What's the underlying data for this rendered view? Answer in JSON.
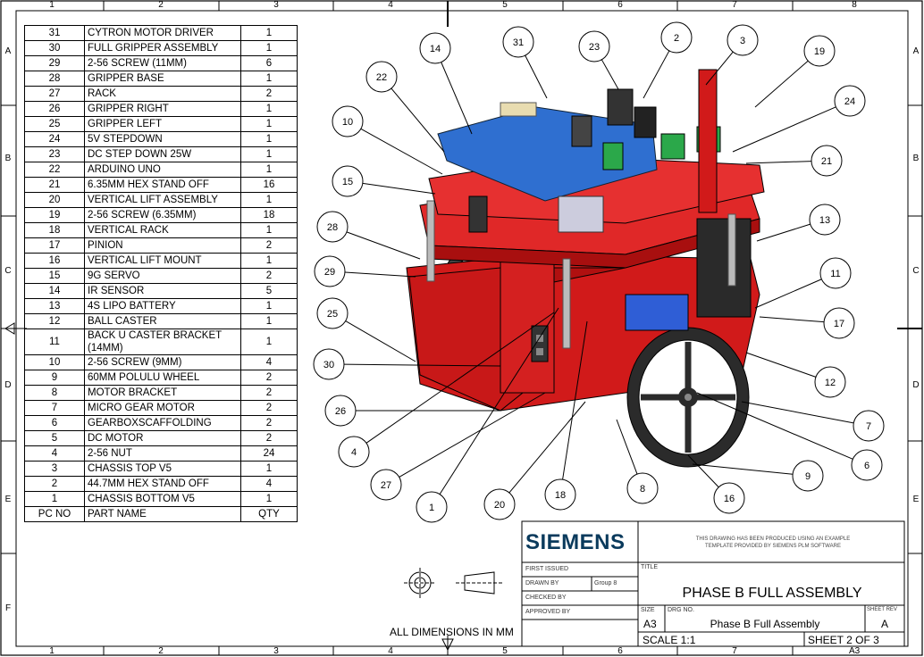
{
  "frame": {
    "columns": [
      "1",
      "2",
      "3",
      "4",
      "5",
      "6",
      "7",
      "8"
    ],
    "rows": [
      "A",
      "B",
      "C",
      "D",
      "E",
      "F"
    ]
  },
  "bom": {
    "rows": [
      {
        "no": "31",
        "name": "CYTRON MOTOR DRIVER",
        "qty": "1"
      },
      {
        "no": "30",
        "name": "FULL GRIPPER ASSEMBLY",
        "qty": "1"
      },
      {
        "no": "29",
        "name": "2-56 SCREW (11MM)",
        "qty": "6"
      },
      {
        "no": "28",
        "name": "GRIPPER BASE",
        "qty": "1"
      },
      {
        "no": "27",
        "name": "RACK",
        "qty": "2"
      },
      {
        "no": "26",
        "name": "GRIPPER RIGHT",
        "qty": "1"
      },
      {
        "no": "25",
        "name": "GRIPPER LEFT",
        "qty": "1"
      },
      {
        "no": "24",
        "name": "5V STEPDOWN",
        "qty": "1"
      },
      {
        "no": "23",
        "name": "DC STEP DOWN 25W",
        "qty": "1"
      },
      {
        "no": "22",
        "name": "ARDUINO UNO",
        "qty": "1"
      },
      {
        "no": "21",
        "name": "6.35MM HEX STAND OFF",
        "qty": "16"
      },
      {
        "no": "20",
        "name": "VERTICAL LIFT ASSEMBLY",
        "qty": "1"
      },
      {
        "no": "19",
        "name": "2-56 SCREW (6.35MM)",
        "qty": "18"
      },
      {
        "no": "18",
        "name": "VERTICAL RACK",
        "qty": "1"
      },
      {
        "no": "17",
        "name": "PINION",
        "qty": "2"
      },
      {
        "no": "16",
        "name": "VERTICAL LIFT MOUNT",
        "qty": "1"
      },
      {
        "no": "15",
        "name": "9G SERVO",
        "qty": "2"
      },
      {
        "no": "14",
        "name": "IR SENSOR",
        "qty": "5"
      },
      {
        "no": "13",
        "name": "4S LIPO BATTERY",
        "qty": "1"
      },
      {
        "no": "12",
        "name": "BALL CASTER",
        "qty": "1"
      },
      {
        "no": "11",
        "name": "BACK U CASTER BRACKET (14MM)",
        "qty": "1"
      },
      {
        "no": "10",
        "name": "2-56 SCREW (9MM)",
        "qty": "4"
      },
      {
        "no": "9",
        "name": "60MM POLULU WHEEL",
        "qty": "2"
      },
      {
        "no": "8",
        "name": "MOTOR BRACKET",
        "qty": "2"
      },
      {
        "no": "7",
        "name": "MICRO GEAR MOTOR",
        "qty": "2"
      },
      {
        "no": "6",
        "name": "GEARBOXSCAFFOLDING",
        "qty": "2"
      },
      {
        "no": "5",
        "name": "DC MOTOR",
        "qty": "2"
      },
      {
        "no": "4",
        "name": "2-56 NUT",
        "qty": "24"
      },
      {
        "no": "3",
        "name": "CHASSIS TOP V5",
        "qty": "1"
      },
      {
        "no": "2",
        "name": "44.7MM HEX STAND OFF",
        "qty": "4"
      },
      {
        "no": "1",
        "name": "CHASSIS BOTTOM V5",
        "qty": "1"
      }
    ],
    "header": {
      "no": "PC NO",
      "name": "PART NAME",
      "qty": "QTY"
    }
  },
  "balloons": [
    "31",
    "23",
    "2",
    "3",
    "14",
    "22",
    "19",
    "24",
    "10",
    "21",
    "15",
    "13",
    "28",
    "11",
    "29",
    "17",
    "25",
    "12",
    "30",
    "7",
    "26",
    "6",
    "4",
    "9",
    "27",
    "8",
    "16",
    "1",
    "20",
    "18"
  ],
  "title_block": {
    "logo": "SIEMENS",
    "notice_line1": "THIS DRAWING HAS BEEN PRODUCED USING AN EXAMPLE",
    "notice_line2": "TEMPLATE PROVIDED BY SIEMENS PLM SOFTWARE",
    "first_issued": "FIRST ISSUED",
    "drawn_by": "DRAWN BY",
    "drawn_by_value": "Group 8",
    "checked_by": "CHECKED BY",
    "approved_by": "APPROVED BY",
    "title_label": "TITLE",
    "title": "PHASE B FULL ASSEMBLY",
    "size_label": "SIZE",
    "size": "A3",
    "dwg_no_label": "DRG NO.",
    "dwg_no": "Phase B Full Assembly",
    "sheet_rev_label": "SHEET REV",
    "rev": "A",
    "scale": "SCALE 1:1",
    "sheet": "SHEET 2 OF 3",
    "dimensions_note": "ALL DIMENSIONS IN MM",
    "bottom_size": "A3"
  },
  "colors": {
    "chassis_red": "#d11a1a",
    "board_blue": "#2f6fd0",
    "wheel_dark": "#2b2b2b"
  }
}
